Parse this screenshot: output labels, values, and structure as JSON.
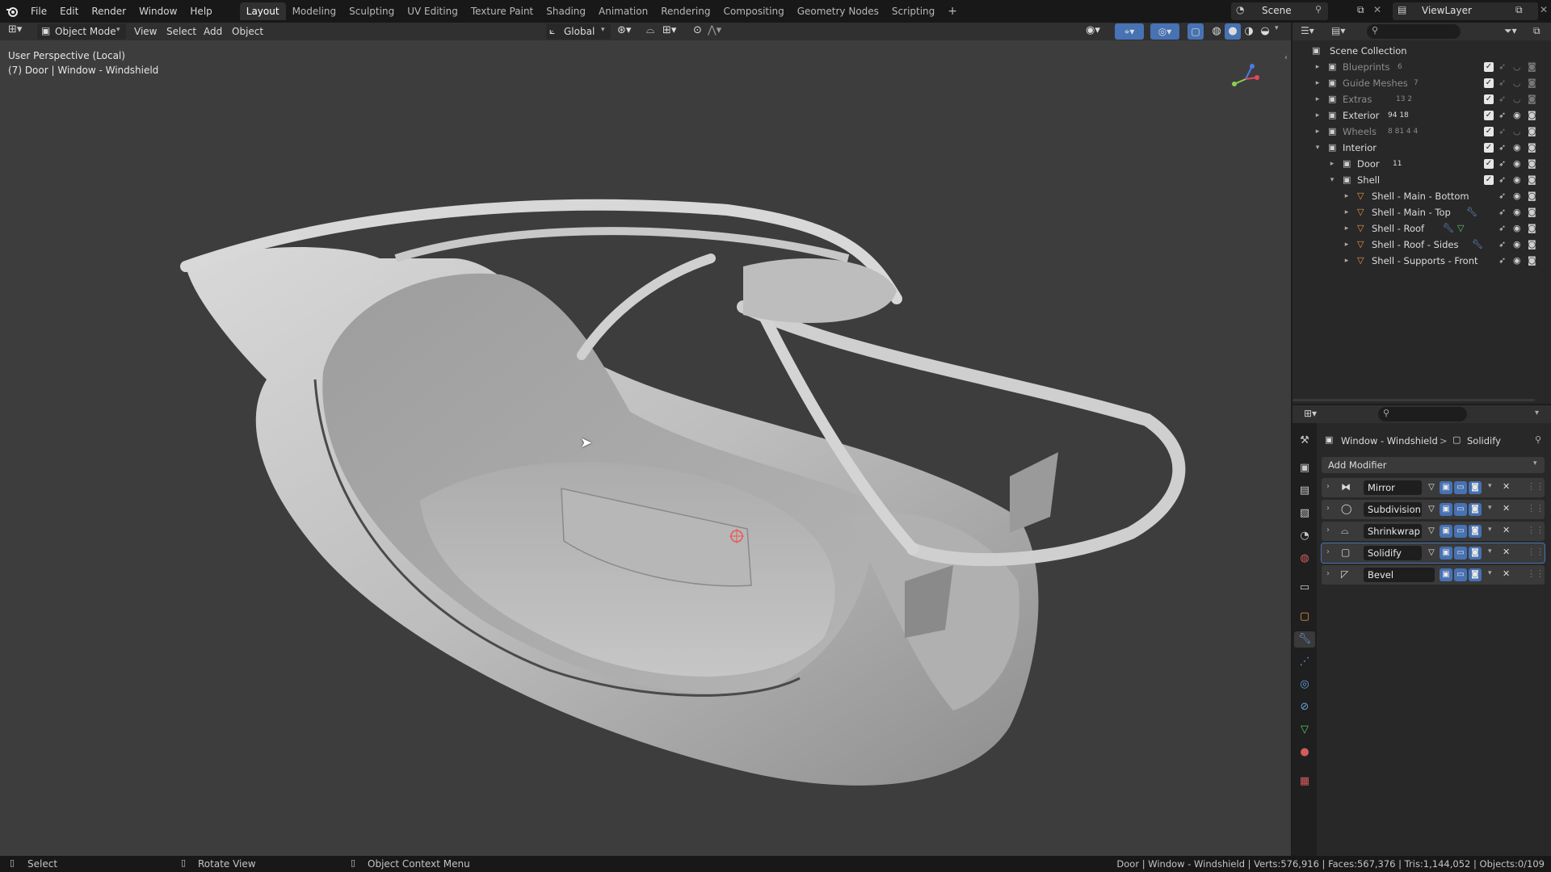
{
  "topbar": {
    "menus": [
      "File",
      "Edit",
      "Render",
      "Window",
      "Help"
    ],
    "workspaces": [
      "Layout",
      "Modeling",
      "Sculpting",
      "UV Editing",
      "Texture Paint",
      "Shading",
      "Animation",
      "Rendering",
      "Compositing",
      "Geometry Nodes",
      "Scripting"
    ],
    "active_workspace": "Layout",
    "add_tab": "+",
    "scene": "Scene",
    "view_layer": "ViewLayer"
  },
  "viewport_header": {
    "mode": "Object Mode",
    "menus": [
      "View",
      "Select",
      "Add",
      "Object"
    ],
    "orientation": "Global"
  },
  "viewport": {
    "perspective_label": "User Perspective (Local)",
    "object_label": "(7) Door | Window - Windshield"
  },
  "outliner": {
    "root": "Scene Collection",
    "rows": [
      {
        "label": "Blueprints",
        "badge": "6",
        "dim": true
      },
      {
        "label": "Guide Meshes",
        "badge": "7",
        "dim": true
      },
      {
        "label": "Extras",
        "badge": "13  2",
        "dim": true
      },
      {
        "label": "Exterior",
        "badge": "94  18",
        "dim": false
      },
      {
        "label": "Wheels",
        "badge": "8  81  4  4",
        "dim": true
      },
      {
        "label": "Interior",
        "badge": "",
        "dim": false
      },
      {
        "label": "Door",
        "badge": "11",
        "dim": false
      },
      {
        "label": "Shell",
        "badge": "",
        "dim": false
      },
      {
        "label": "Shell - Main - Bottom",
        "badge": "",
        "dim": false
      },
      {
        "label": "Shell - Main - Top",
        "badge": "",
        "dim": false
      },
      {
        "label": "Shell - Roof",
        "badge": "",
        "dim": false
      },
      {
        "label": "Shell - Roof - Sides",
        "badge": "",
        "dim": false
      },
      {
        "label": "Shell - Supports - Front",
        "badge": "",
        "dim": false
      }
    ]
  },
  "properties": {
    "breadcrumb_object": "Window - Windshield",
    "breadcrumb_sep": ">",
    "breadcrumb_modifier": "Solidify",
    "add_modifier": "Add Modifier",
    "modifiers": [
      "Mirror",
      "Subdivision",
      "Shrinkwrap",
      "Solidify",
      "Bevel"
    ],
    "active_modifier": "Solidify"
  },
  "statusbar": {
    "left1": "Select",
    "left2": "Rotate View",
    "left3": "Object Context Menu",
    "stats": "Door | Window - Windshield | Verts:576,916 | Faces:567,376 | Tris:1,144,052 | Objects:0/109"
  },
  "colors": {
    "accent": "#4772b3",
    "viewport_bg": "#3d3d3d",
    "panel_bg": "#282828"
  }
}
